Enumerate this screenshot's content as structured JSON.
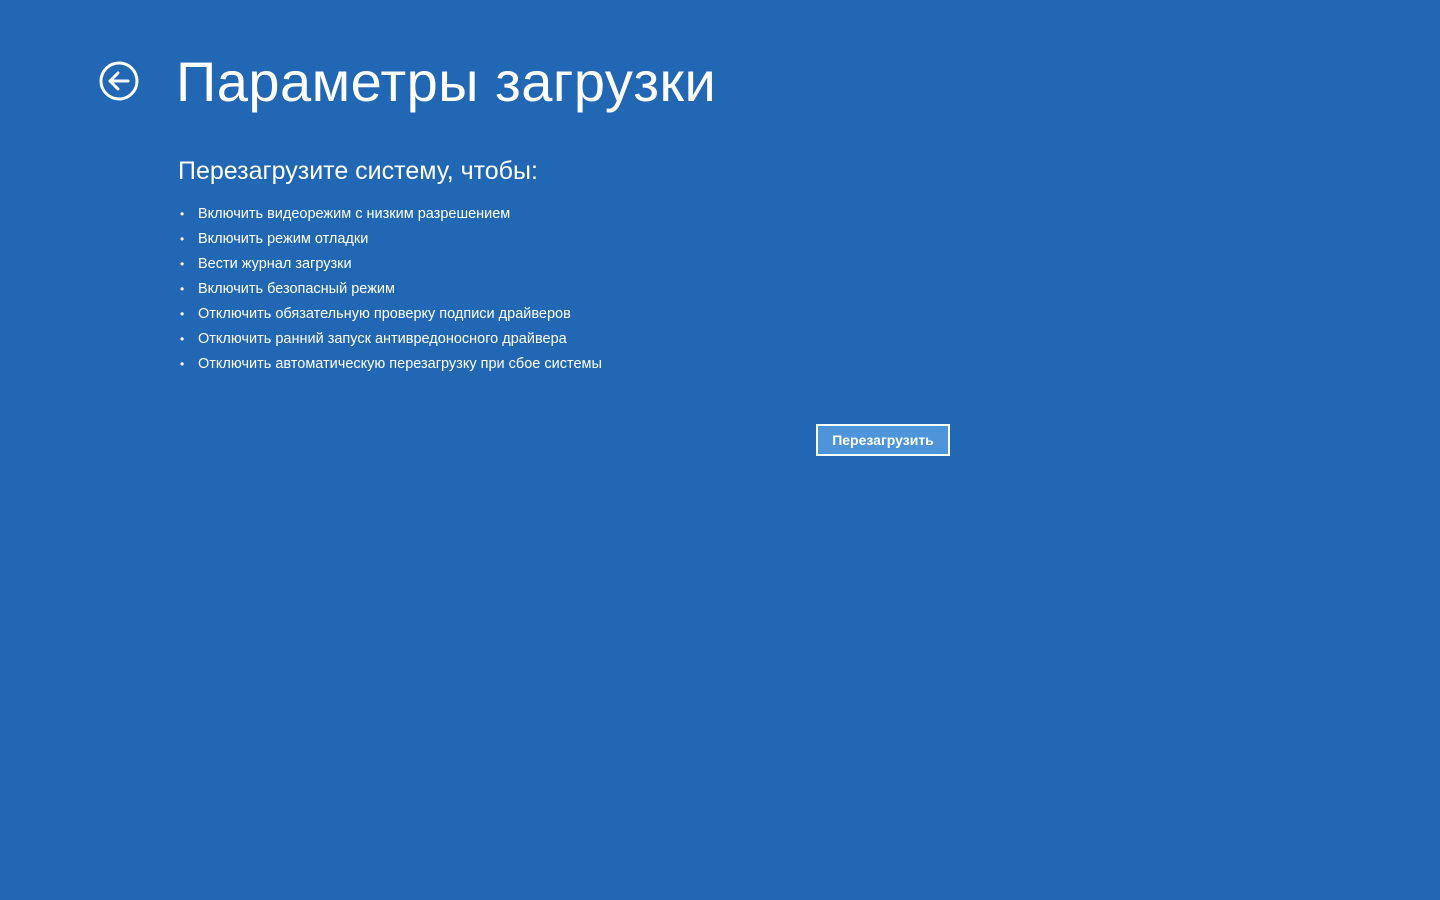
{
  "header": {
    "title": "Параметры загрузки",
    "back_icon": "back-arrow-circle-icon"
  },
  "content": {
    "subtitle": "Перезагрузите систему, чтобы:",
    "bullet_char": "•",
    "options": [
      "Включить видеорежим с низким разрешением",
      "Включить режим отладки",
      "Вести журнал загрузки",
      "Включить безопасный режим",
      "Отключить обязательную проверку подписи драйверов",
      "Отключить ранний запуск антивредоносного драйвера",
      "Отключить автоматическую перезагрузку при сбое системы"
    ]
  },
  "actions": {
    "restart_label": "Перезагрузить"
  },
  "colors": {
    "background": "#2167b4",
    "text": "#ffffff",
    "button_fill": "#4d94d8"
  }
}
